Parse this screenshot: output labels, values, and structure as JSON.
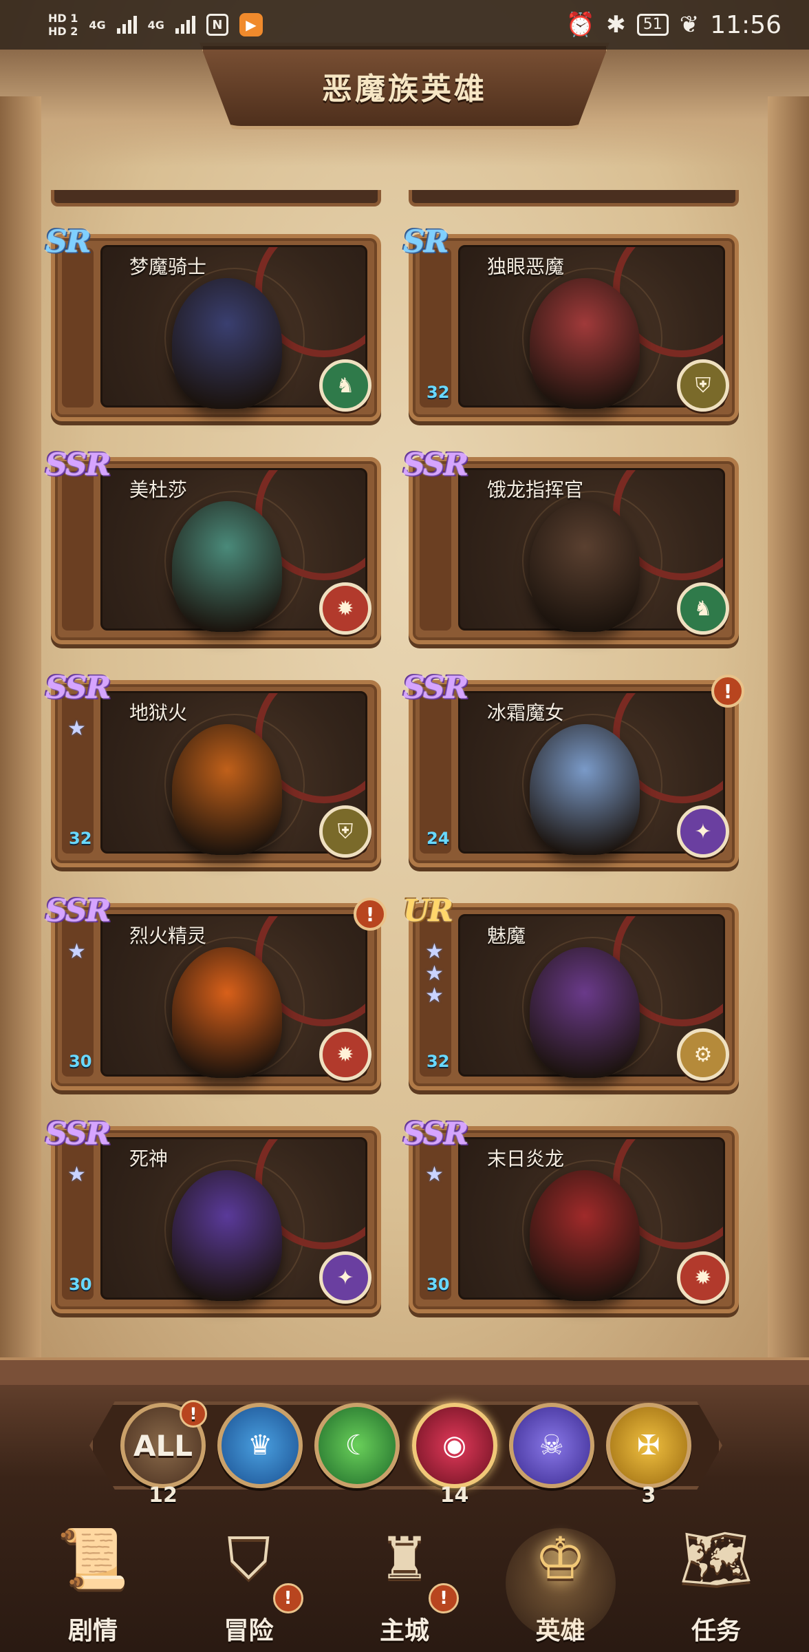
{
  "status_bar": {
    "hd1": "HD 1",
    "hd2": "HD 2",
    "net1": "4G",
    "net2": "4G",
    "nfc": "N",
    "battery": "51",
    "time": "11:56"
  },
  "title": "恶魔族英雄",
  "heroes": [
    {
      "name": "梦魔骑士",
      "rarity": "SR",
      "rarity_class": "sr",
      "level": "",
      "stars": 0,
      "class_icon": "knight-class-icon",
      "class_glyph": "♞",
      "alert": false,
      "color": "#3a3f70"
    },
    {
      "name": "独眼恶魔",
      "rarity": "SR",
      "rarity_class": "sr",
      "level": "32",
      "stars": 0,
      "class_icon": "warrior-class-icon",
      "class_glyph": "⛨",
      "alert": false,
      "color": "#a03a3a"
    },
    {
      "name": "美杜莎",
      "rarity": "SSR",
      "rarity_class": "ssr",
      "level": "",
      "stars": 0,
      "class_icon": "cannon-class-icon",
      "class_glyph": "✹",
      "alert": false,
      "color": "#4a8a7a"
    },
    {
      "name": "饿龙指挥官",
      "rarity": "SSR",
      "rarity_class": "ssr",
      "level": "",
      "stars": 0,
      "class_icon": "knight-class-icon",
      "class_glyph": "♞",
      "alert": false,
      "color": "#5a4030"
    },
    {
      "name": "地狱火",
      "rarity": "SSR",
      "rarity_class": "ssr",
      "level": "32",
      "stars": 1,
      "class_icon": "warrior-class-icon",
      "class_glyph": "⛨",
      "alert": false,
      "color": "#c0601a"
    },
    {
      "name": "冰霜魔女",
      "rarity": "SSR",
      "rarity_class": "ssr",
      "level": "24",
      "stars": 0,
      "class_icon": "mage-class-icon",
      "class_glyph": "✦",
      "alert": true,
      "color": "#7a9ac8"
    },
    {
      "name": "烈火精灵",
      "rarity": "SSR",
      "rarity_class": "ssr",
      "level": "30",
      "stars": 1,
      "class_icon": "cannon-class-icon",
      "class_glyph": "✹",
      "alert": true,
      "color": "#d8601a"
    },
    {
      "name": "魅魔",
      "rarity": "UR",
      "rarity_class": "ur",
      "level": "32",
      "stars": 3,
      "class_icon": "support-class-icon",
      "class_glyph": "⚙",
      "alert": false,
      "color": "#6a3a8a"
    },
    {
      "name": "死神",
      "rarity": "SSR",
      "rarity_class": "ssr",
      "level": "30",
      "stars": 1,
      "class_icon": "mage-class-icon",
      "class_glyph": "✦",
      "alert": false,
      "color": "#5a3a9a"
    },
    {
      "name": "末日炎龙",
      "rarity": "SSR",
      "rarity_class": "ssr",
      "level": "30",
      "stars": 1,
      "class_icon": "cannon-class-icon",
      "class_glyph": "✹",
      "alert": false,
      "color": "#a02a2a"
    }
  ],
  "filters": [
    {
      "label": "ALL",
      "count": "12",
      "alert": true,
      "icon": "all-filter-icon",
      "glyph": "ALL",
      "cls": "all"
    },
    {
      "label": "",
      "count": "",
      "alert": false,
      "icon": "crown-faction-icon",
      "glyph": "♛",
      "cls": "holy"
    },
    {
      "label": "",
      "count": "",
      "alert": false,
      "icon": "moon-faction-icon",
      "glyph": "☾",
      "cls": "nature"
    },
    {
      "label": "",
      "count": "14",
      "alert": false,
      "icon": "eye-faction-icon",
      "glyph": "◉",
      "cls": "demon"
    },
    {
      "label": "",
      "count": "",
      "alert": false,
      "icon": "ghost-faction-icon",
      "glyph": "☠",
      "cls": "undead"
    },
    {
      "label": "",
      "count": "3",
      "alert": false,
      "icon": "wings-faction-icon",
      "glyph": "✠",
      "cls": "heaven"
    }
  ],
  "nav": [
    {
      "label": "剧情",
      "icon": "scroll-icon",
      "glyph": "📜",
      "alert": false,
      "active": false
    },
    {
      "label": "冒险",
      "icon": "shield-icon",
      "glyph": "⛉",
      "alert": true,
      "active": false
    },
    {
      "label": "主城",
      "icon": "castle-icon",
      "glyph": "♜",
      "alert": true,
      "active": false
    },
    {
      "label": "英雄",
      "icon": "helmet-icon",
      "glyph": "♔",
      "alert": false,
      "active": true
    },
    {
      "label": "任务",
      "icon": "map-icon",
      "glyph": "🗺",
      "alert": false,
      "active": false
    }
  ],
  "alert_glyph": "!",
  "star_glyph": "★"
}
